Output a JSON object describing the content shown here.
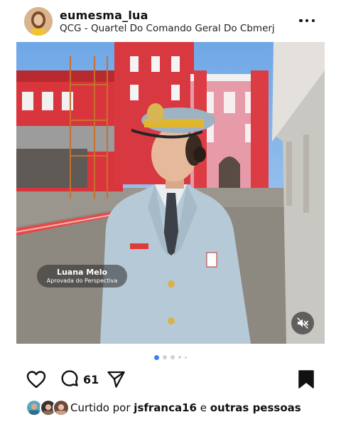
{
  "post": {
    "username": "eumesma_lua",
    "location": "QCG - Quartel Do Comando Geral Do Cbmerj",
    "more_icon": "more-horizontal-icon"
  },
  "photo": {
    "name_tag": {
      "name": "Luana Melo",
      "subtitle": "Aprovada do Perspectiva"
    },
    "mute_icon": "speaker-muted-icon"
  },
  "carousel": {
    "total_dots": 5,
    "active_index": 0
  },
  "actions": {
    "like_icon": "heart-icon",
    "comment_icon": "comment-bubble-icon",
    "comment_count": "61",
    "share_icon": "send-paper-plane-icon",
    "save_icon": "bookmark-filled-icon"
  },
  "likes": {
    "prefix": "Curtido por ",
    "user": "jsfranca16",
    "connector": " e ",
    "others": "outras pessoas"
  },
  "colors": {
    "active_dot": "#3b82f6",
    "building_red": "#d9353c",
    "uniform": "#b6c9d6"
  }
}
